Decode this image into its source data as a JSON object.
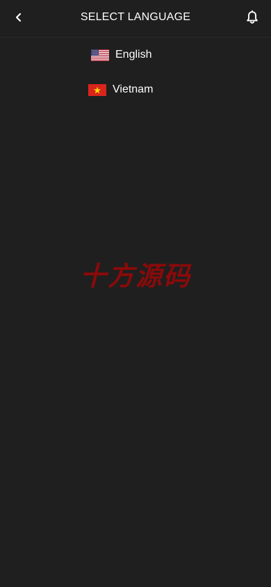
{
  "header": {
    "title": "SELECT LANGUAGE",
    "back_icon": "chevron-left-icon",
    "bell_icon": "bell-icon"
  },
  "languages": [
    {
      "label": "English",
      "flag": "us-flag-icon"
    },
    {
      "label": "Vietnam",
      "flag": "vietnam-flag-icon"
    }
  ],
  "watermark": "十方源码",
  "colors": {
    "background": "#1f1f1f",
    "text": "#ffffff",
    "watermark": "#8a0a0a"
  }
}
